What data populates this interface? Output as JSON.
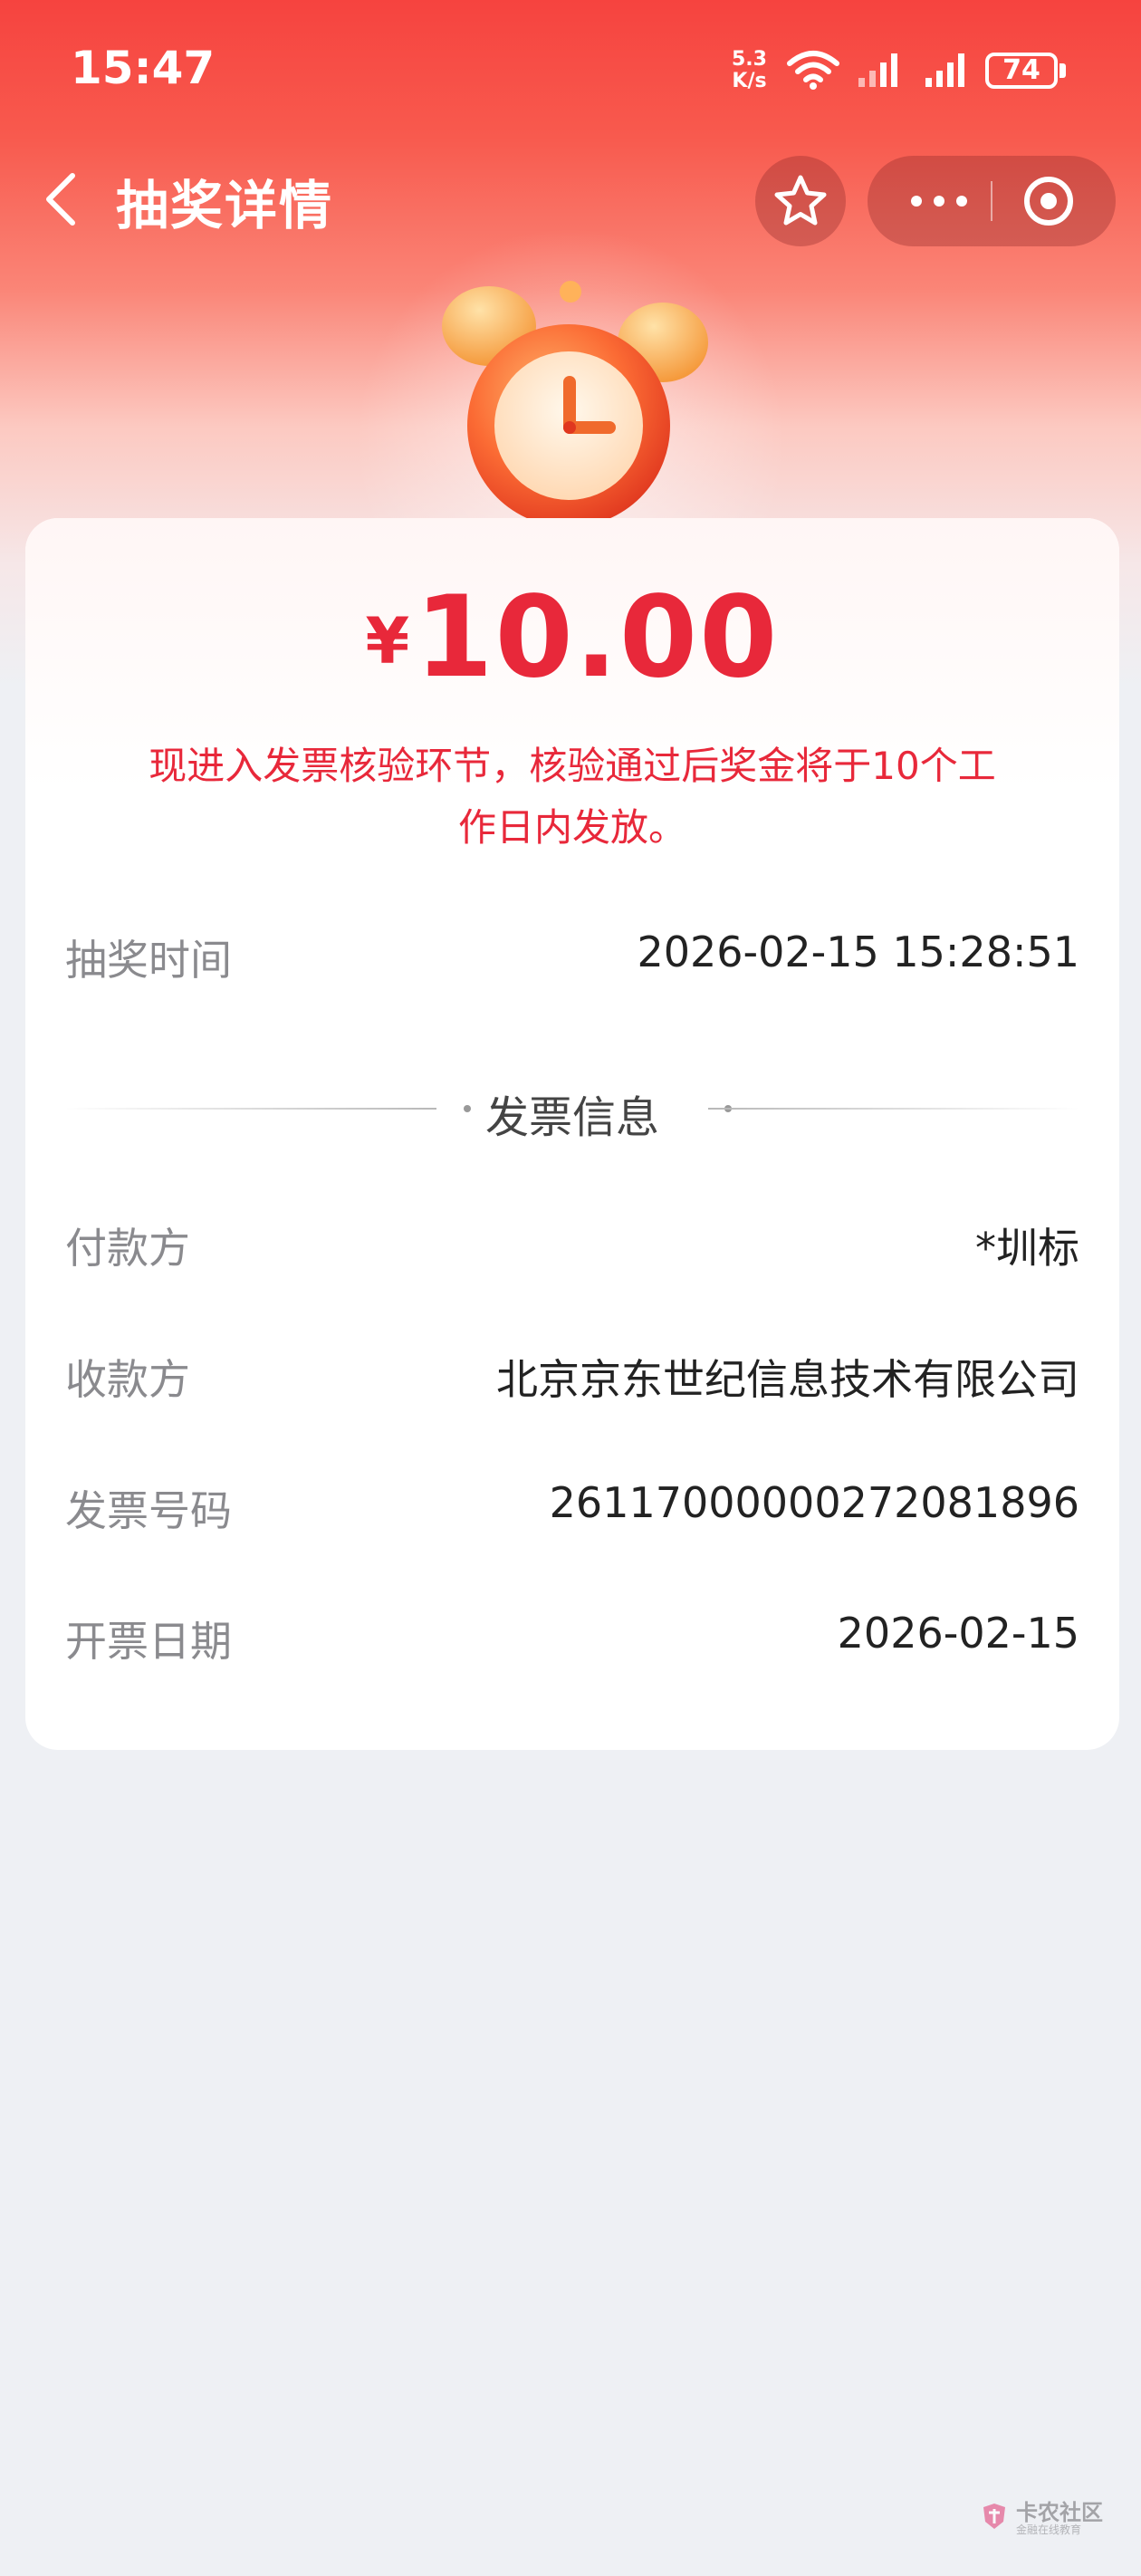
{
  "status_bar": {
    "time": "15:47",
    "net_speed_value": "5.3",
    "net_speed_unit": "K/s",
    "battery_level": "74"
  },
  "nav": {
    "title": "抽奖详情"
  },
  "prize": {
    "currency": "¥",
    "amount": "10.00",
    "notice": "现进入发票核验环节，核验通过后奖金将于10个工作日内发放。"
  },
  "lottery": {
    "time_label": "抽奖时间",
    "time_value": "2026-02-15 15:28:51"
  },
  "invoice": {
    "section_title": "发票信息",
    "payer_label": "付款方",
    "payer_value": "*圳标",
    "payee_label": "收款方",
    "payee_value": "北京京东世纪信息技术有限公司",
    "number_label": "发票号码",
    "number_value": "26117000000272081896",
    "date_label": "开票日期",
    "date_value": "2026-02-15"
  },
  "watermark": {
    "name": "卡农社区",
    "sub": "金融在线教育"
  },
  "colors": {
    "accent_red": "#e8283a",
    "header_red": "#f6433f",
    "page_bg": "#eef0f4"
  },
  "icons": [
    "back-icon",
    "star-icon",
    "more-icon",
    "target-icon",
    "wifi-icon",
    "signal-icon",
    "battery-icon",
    "alarm-clock-icon"
  ]
}
